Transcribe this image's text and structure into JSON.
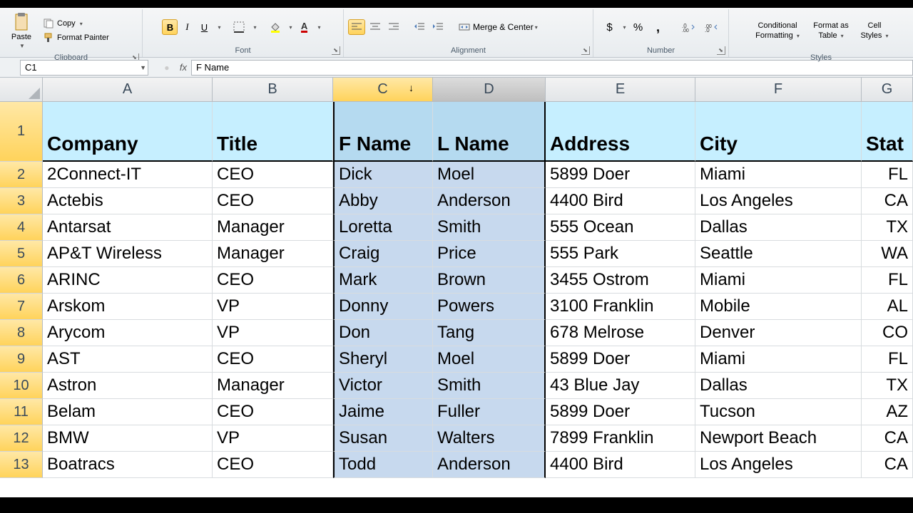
{
  "ribbon": {
    "clipboard": {
      "label": "Clipboard",
      "paste": "Paste",
      "copy": "Copy",
      "format_painter": "Format Painter"
    },
    "font": {
      "label": "Font"
    },
    "alignment": {
      "label": "Alignment",
      "merge": "Merge & Center"
    },
    "number": {
      "label": "Number"
    },
    "styles": {
      "label": "Styles",
      "conditional1": "Conditional",
      "conditional2": "Formatting",
      "formatas1": "Format as",
      "formatas2": "Table",
      "cell1": "Cell",
      "cell2": "Styles"
    }
  },
  "formula": {
    "name_box": "C1",
    "value": "F Name",
    "fx": "fx"
  },
  "columns": [
    "A",
    "B",
    "C",
    "D",
    "E",
    "F",
    "G"
  ],
  "headers": [
    "Company",
    "Title",
    "F Name",
    "L Name",
    "Address",
    "City",
    "Stat"
  ],
  "rows": [
    {
      "n": 2,
      "d": [
        "2Connect-IT",
        "CEO",
        "Dick",
        "Moel",
        "5899 Doer",
        "Miami",
        "FL"
      ]
    },
    {
      "n": 3,
      "d": [
        "Actebis",
        "CEO",
        "Abby",
        "Anderson",
        "4400 Bird",
        "Los Angeles",
        "CA"
      ]
    },
    {
      "n": 4,
      "d": [
        "Antarsat",
        "Manager",
        "Loretta",
        "Smith",
        "555 Ocean",
        "Dallas",
        "TX"
      ]
    },
    {
      "n": 5,
      "d": [
        "AP&T Wireless",
        "Manager",
        "Craig",
        "Price",
        "555 Park",
        "Seattle",
        "WA"
      ]
    },
    {
      "n": 6,
      "d": [
        "ARINC",
        "CEO",
        "Mark",
        "Brown",
        "3455 Ostrom",
        "Miami",
        "FL"
      ]
    },
    {
      "n": 7,
      "d": [
        "Arskom",
        "VP",
        "Donny",
        "Powers",
        "3100 Franklin",
        "Mobile",
        "AL"
      ]
    },
    {
      "n": 8,
      "d": [
        "Arycom",
        "VP",
        "Don",
        "Tang",
        "678 Melrose",
        "Denver",
        "CO"
      ]
    },
    {
      "n": 9,
      "d": [
        "AST",
        "CEO",
        "Sheryl",
        "Moel",
        "5899 Doer",
        "Miami",
        "FL"
      ]
    },
    {
      "n": 10,
      "d": [
        "Astron",
        "Manager",
        "Victor",
        "Smith",
        "43 Blue Jay",
        "Dallas",
        "TX"
      ]
    },
    {
      "n": 11,
      "d": [
        "Belam",
        "CEO",
        "Jaime",
        "Fuller",
        "5899 Doer",
        "Tucson",
        "AZ"
      ]
    },
    {
      "n": 12,
      "d": [
        "BMW",
        "VP",
        "Susan",
        "Walters",
        "7899 Franklin",
        "Newport Beach",
        "CA"
      ]
    },
    {
      "n": 13,
      "d": [
        "Boatracs",
        "CEO",
        "Todd",
        "Anderson",
        "4400 Bird",
        "Los Angeles",
        "CA"
      ]
    }
  ]
}
